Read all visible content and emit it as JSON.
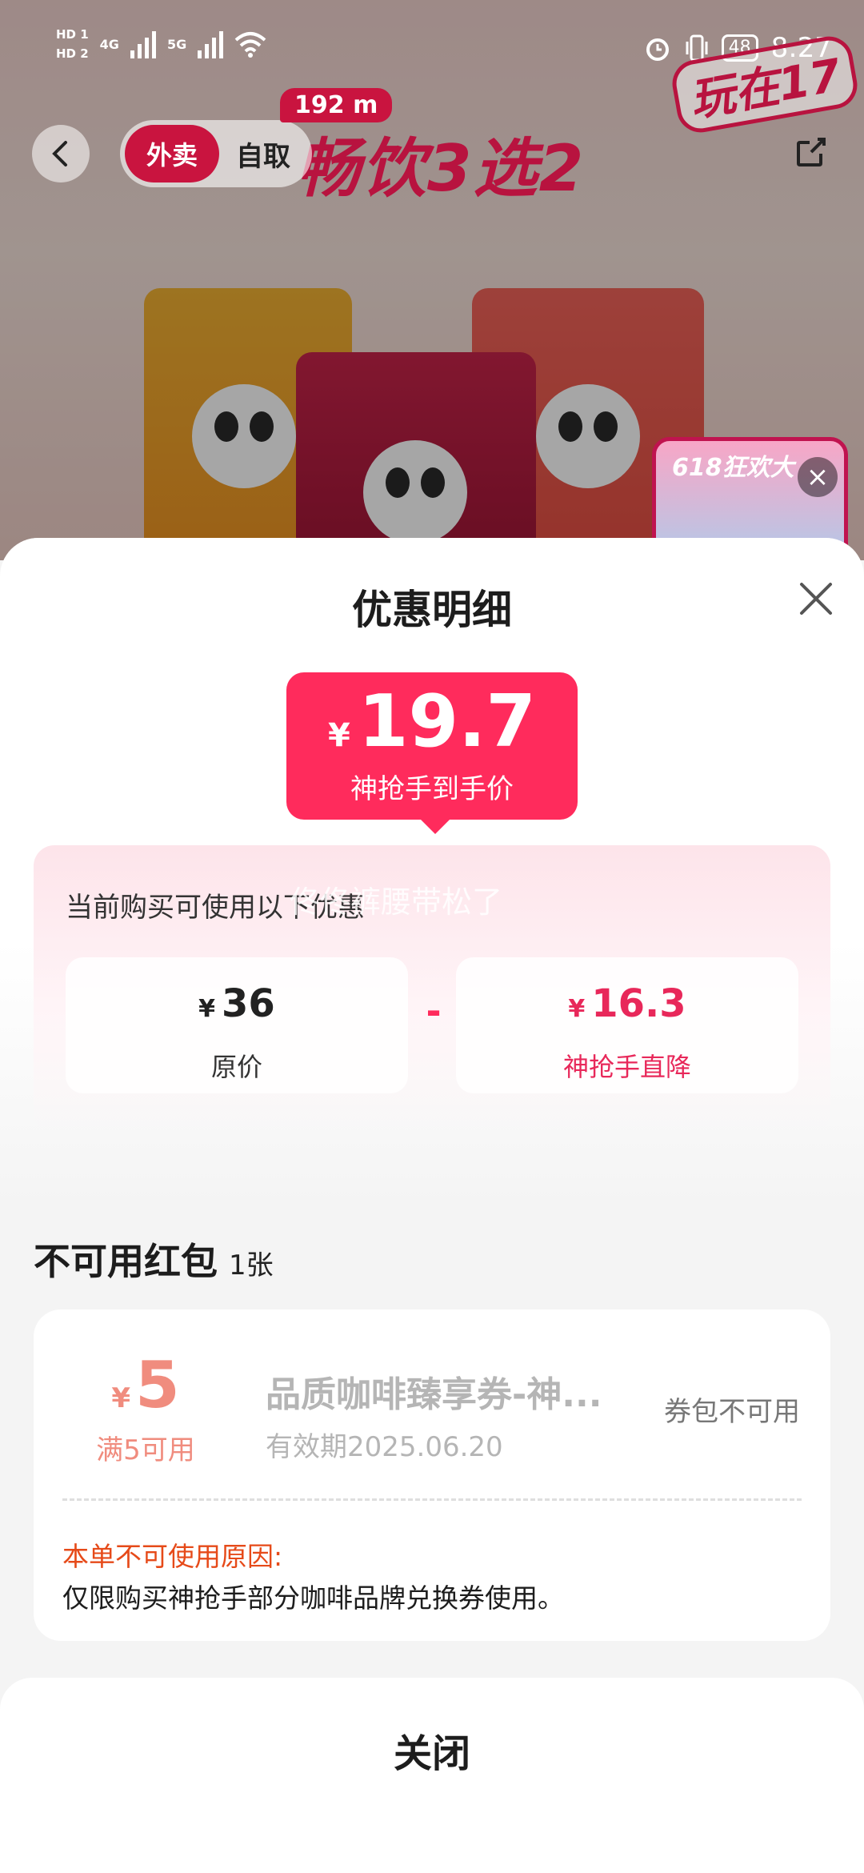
{
  "status_bar": {
    "sim1": "HD 1",
    "sim2": "HD 2",
    "net1": "4G",
    "net2": "5G",
    "battery": "48",
    "time": "8:27",
    "icons": [
      "alarm-icon",
      "vibrate-icon",
      "wifi-icon",
      "signal-icon"
    ]
  },
  "nav": {
    "back_icon": "chevron-left-icon",
    "mode_active": "外卖",
    "mode_inactive": "自取",
    "distance": "192 m",
    "banner_title": "畅饮3选2",
    "brand_badge": "玩在17",
    "share_icon": "share-icon"
  },
  "promo_overlay": {
    "label": "618狂欢大",
    "close_icon": "close-icon"
  },
  "sheet": {
    "title": "优惠明细",
    "close_icon": "close-icon",
    "final_price": {
      "symbol": "¥",
      "amount": "19.7",
      "label": "神抢手到手价"
    },
    "discount": {
      "intro": "当前购买可使用以下优惠",
      "watermark": "佟佟裤腰带松了",
      "original": {
        "symbol": "¥",
        "amount": "36",
        "label": "原价"
      },
      "operator": "-",
      "reduction": {
        "symbol": "¥",
        "amount": "16.3",
        "label": "神抢手直降"
      }
    },
    "unavailable": {
      "title": "不可用红包",
      "count": "1张",
      "coupon": {
        "symbol": "¥",
        "amount": "5",
        "condition": "满5可用",
        "name": "品质咖啡臻享券-神...",
        "expiry": "有效期2025.06.20",
        "status": "券包不可用",
        "reason_title": "本单不可使用原因:",
        "reason_text": "仅限购买神抢手部分咖啡品牌兑换券使用。"
      }
    },
    "footer_button": "关闭"
  },
  "colors": {
    "accent": "#ff2b5c",
    "brand_dark": "#c9143f",
    "coupon_amount": "#f08c7e",
    "reason_title": "#e64a19"
  }
}
